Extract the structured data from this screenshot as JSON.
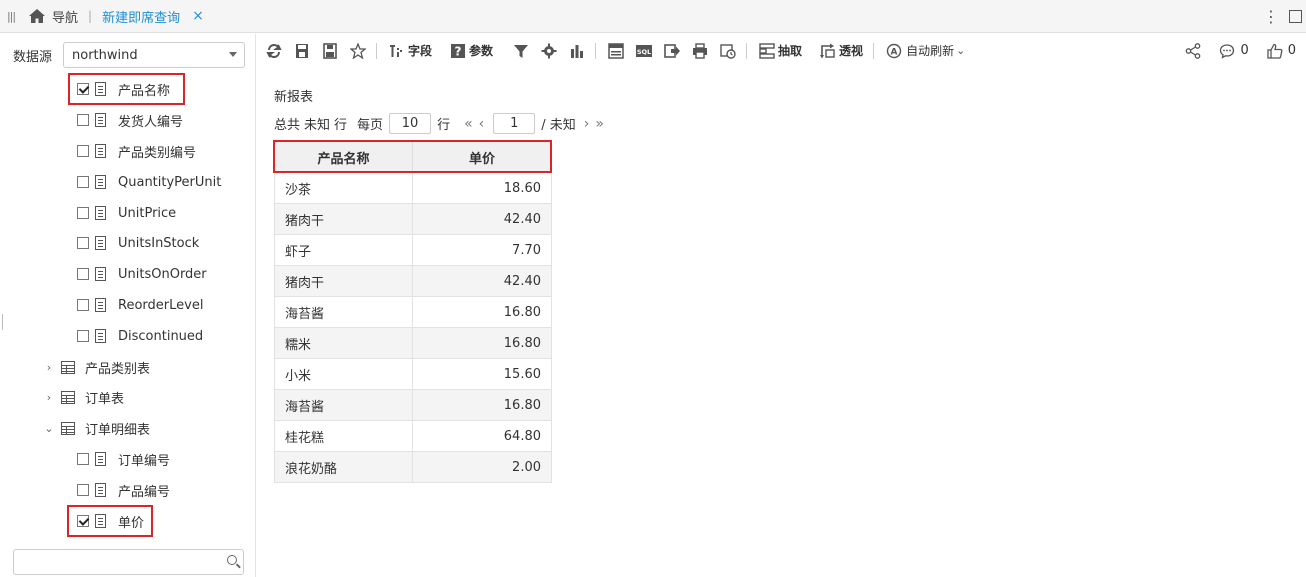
{
  "topbar": {
    "nav_label": "导航",
    "tab_label": "新建即席查询",
    "tab_close": "×",
    "more": "⋮"
  },
  "left": {
    "datasource_label": "数据源",
    "datasource_value": "northwind",
    "tree": [
      {
        "label": "产品名称",
        "kind": "field",
        "checked": true
      },
      {
        "label": "发货人编号",
        "kind": "field",
        "checked": false
      },
      {
        "label": "产品类别编号",
        "kind": "field",
        "checked": false
      },
      {
        "label": "QuantityPerUnit",
        "kind": "field",
        "checked": false
      },
      {
        "label": "UnitPrice",
        "kind": "field",
        "checked": false
      },
      {
        "label": "UnitsInStock",
        "kind": "field",
        "checked": false
      },
      {
        "label": "UnitsOnOrder",
        "kind": "field",
        "checked": false
      },
      {
        "label": "ReorderLevel",
        "kind": "field",
        "checked": false
      },
      {
        "label": "Discontinued",
        "kind": "field",
        "checked": false
      },
      {
        "label": "产品类别表",
        "kind": "table",
        "expanded": false
      },
      {
        "label": "订单表",
        "kind": "table",
        "expanded": false
      },
      {
        "label": "订单明细表",
        "kind": "table",
        "expanded": true
      },
      {
        "label": "订单编号",
        "kind": "field",
        "checked": false
      },
      {
        "label": "产品编号",
        "kind": "field",
        "checked": false
      },
      {
        "label": "单价",
        "kind": "field",
        "checked": true
      }
    ]
  },
  "toolbar": {
    "fields_label": "字段",
    "params_label": "参数",
    "sql_label": "SQL",
    "extract_label": "抽取",
    "pivot_label": "透视",
    "auto_refresh_label": "自动刷新",
    "comment_count": "0",
    "like_count": "0"
  },
  "report": {
    "title": "新报表",
    "pager": {
      "total_prefix": "总共",
      "total_value": "未知",
      "total_suffix": "行",
      "per_page_label": "每页",
      "per_page_value": "10",
      "per_page_suffix": "行",
      "current_page": "1",
      "page_total": "/ 未知"
    },
    "columns": [
      "产品名称",
      "单价"
    ],
    "rows": [
      [
        "沙茶",
        "18.60"
      ],
      [
        "猪肉干",
        "42.40"
      ],
      [
        "虾子",
        "7.70"
      ],
      [
        "猪肉干",
        "42.40"
      ],
      [
        "海苔酱",
        "16.80"
      ],
      [
        "糯米",
        "16.80"
      ],
      [
        "小米",
        "15.60"
      ],
      [
        "海苔酱",
        "16.80"
      ],
      [
        "桂花糕",
        "64.80"
      ],
      [
        "浪花奶酪",
        "2.00"
      ]
    ]
  },
  "colors": {
    "accent": "#1f8fd6",
    "highlight": "#d9252a"
  }
}
